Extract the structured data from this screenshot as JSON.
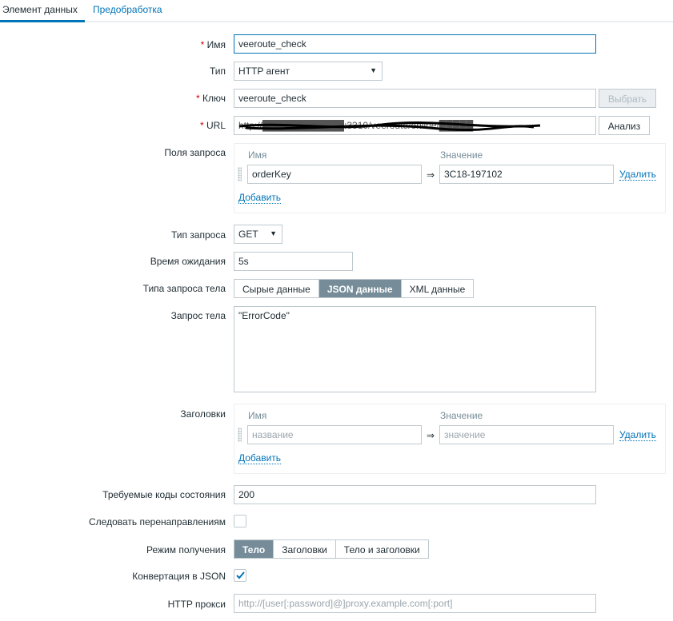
{
  "tabs": [
    {
      "label": "Элемент данных"
    },
    {
      "label": "Предобработка"
    }
  ],
  "form": {
    "required_mark": "*",
    "name": {
      "label": "Имя",
      "value": "veeroute_check"
    },
    "type": {
      "label": "Тип",
      "value": "HTTP агент"
    },
    "key": {
      "label": "Ключ",
      "value": "veeroute_check",
      "button": "Выбрать"
    },
    "url": {
      "label": "URL",
      "value": "http://████████████:3310/veeroute/online/█████",
      "button": "Анализ"
    },
    "query_fields": {
      "label": "Поля запроса",
      "col_name": "Имя",
      "col_value": "Значение",
      "rows": [
        {
          "name": "orderKey",
          "value": "3C18-197102"
        }
      ],
      "remove": "Удалить",
      "add": "Добавить",
      "arrow": "⇒"
    },
    "request_type": {
      "label": "Тип запроса",
      "value": "GET"
    },
    "timeout": {
      "label": "Время ожидания",
      "value": "5s"
    },
    "body_type": {
      "label": "Типа запроса тела",
      "options": [
        "Сырые данные",
        "JSON данные",
        "XML данные"
      ],
      "selected": "JSON данные"
    },
    "body": {
      "label": "Запрос тела",
      "value": "\"ErrorCode\""
    },
    "headers": {
      "label": "Заголовки",
      "col_name": "Имя",
      "col_value": "Значение",
      "name_placeholder": "название",
      "value_placeholder": "значение",
      "remove": "Удалить",
      "add": "Добавить",
      "arrow": "⇒"
    },
    "status_codes": {
      "label": "Требуемые коды состояния",
      "value": "200"
    },
    "follow_redirects": {
      "label": "Следовать перенаправлениям",
      "checked": false
    },
    "retrieve_mode": {
      "label": "Режим получения",
      "options": [
        "Тело",
        "Заголовки",
        "Тело и заголовки"
      ],
      "selected": "Тело"
    },
    "convert_json": {
      "label": "Конвертация в JSON",
      "checked": true
    },
    "http_proxy": {
      "label": "HTTP прокси",
      "placeholder": "http://[user[:password]@]proxy.example.com[:port]"
    }
  }
}
